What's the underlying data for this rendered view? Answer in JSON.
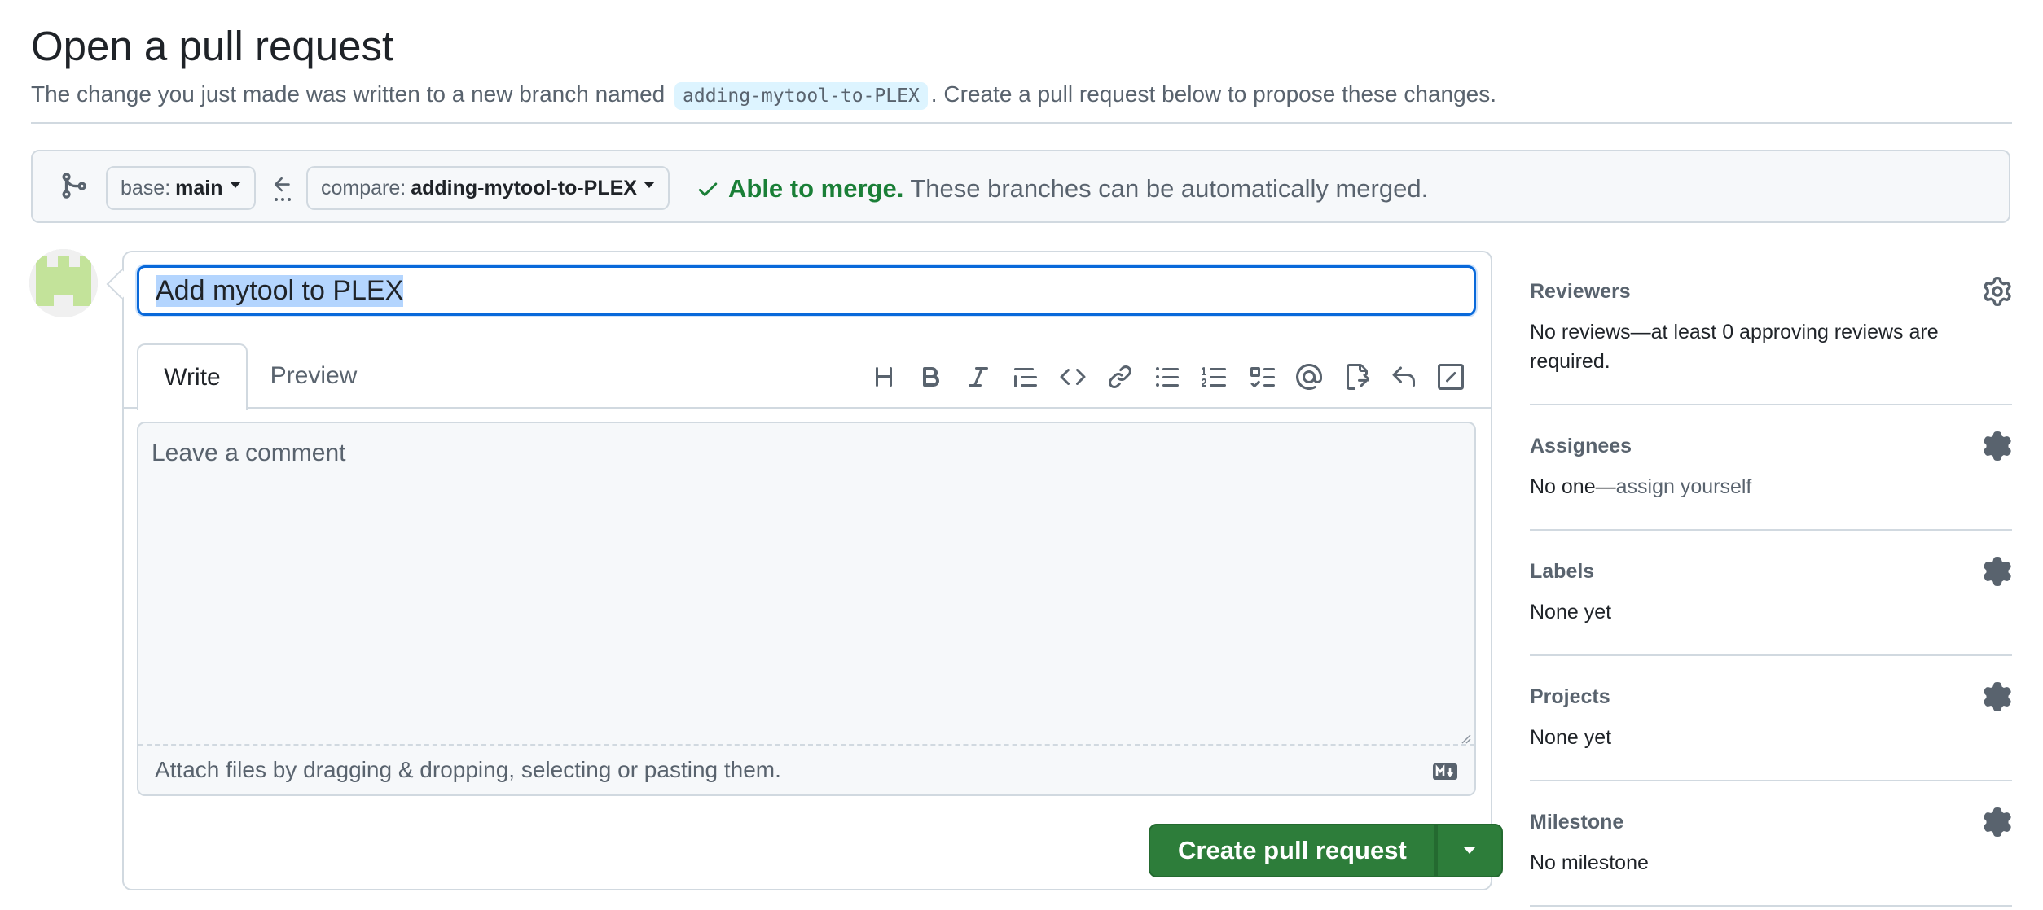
{
  "header": {
    "title": "Open a pull request",
    "subtitle_before": "The change you just made was written to a new branch named",
    "branch_name": "adding-mytool-to-PLEX",
    "subtitle_after": ". Create a pull request below to propose these changes."
  },
  "range": {
    "base_key": "base:",
    "base_value": "main",
    "compare_key": "compare:",
    "compare_value": "adding-mytool-to-PLEX",
    "merge_ok": "Able to merge.",
    "merge_desc": "These branches can be automatically merged."
  },
  "form": {
    "title_value": "Add mytool to PLEX",
    "tabs": [
      {
        "label": "Write"
      },
      {
        "label": "Preview"
      }
    ],
    "comment_placeholder": "Leave a comment",
    "attach_text": "Attach files by dragging & dropping, selecting or pasting them.",
    "toolbar_icons": [
      "heading-icon",
      "bold-icon",
      "italic-icon",
      "quote-icon",
      "code-icon",
      "link-icon",
      "unordered-list-icon",
      "ordered-list-icon",
      "task-list-icon",
      "mention-icon",
      "cross-reference-icon",
      "reply-icon",
      "slash-command-icon"
    ],
    "submit_label": "Create pull request"
  },
  "sidebar": {
    "reviewers": {
      "heading": "Reviewers",
      "value": "No reviews—at least 0 approving reviews are required."
    },
    "assignees": {
      "heading": "Assignees",
      "value": "No one—",
      "link": "assign yourself"
    },
    "labels": {
      "heading": "Labels",
      "value": "None yet"
    },
    "projects": {
      "heading": "Projects",
      "value": "None yet"
    },
    "milestone": {
      "heading": "Milestone",
      "value": "No milestone"
    }
  },
  "colors": {
    "accent": "#0969da",
    "success": "#1a7f37",
    "button": "#2d7d3a",
    "muted": "#59636e"
  }
}
